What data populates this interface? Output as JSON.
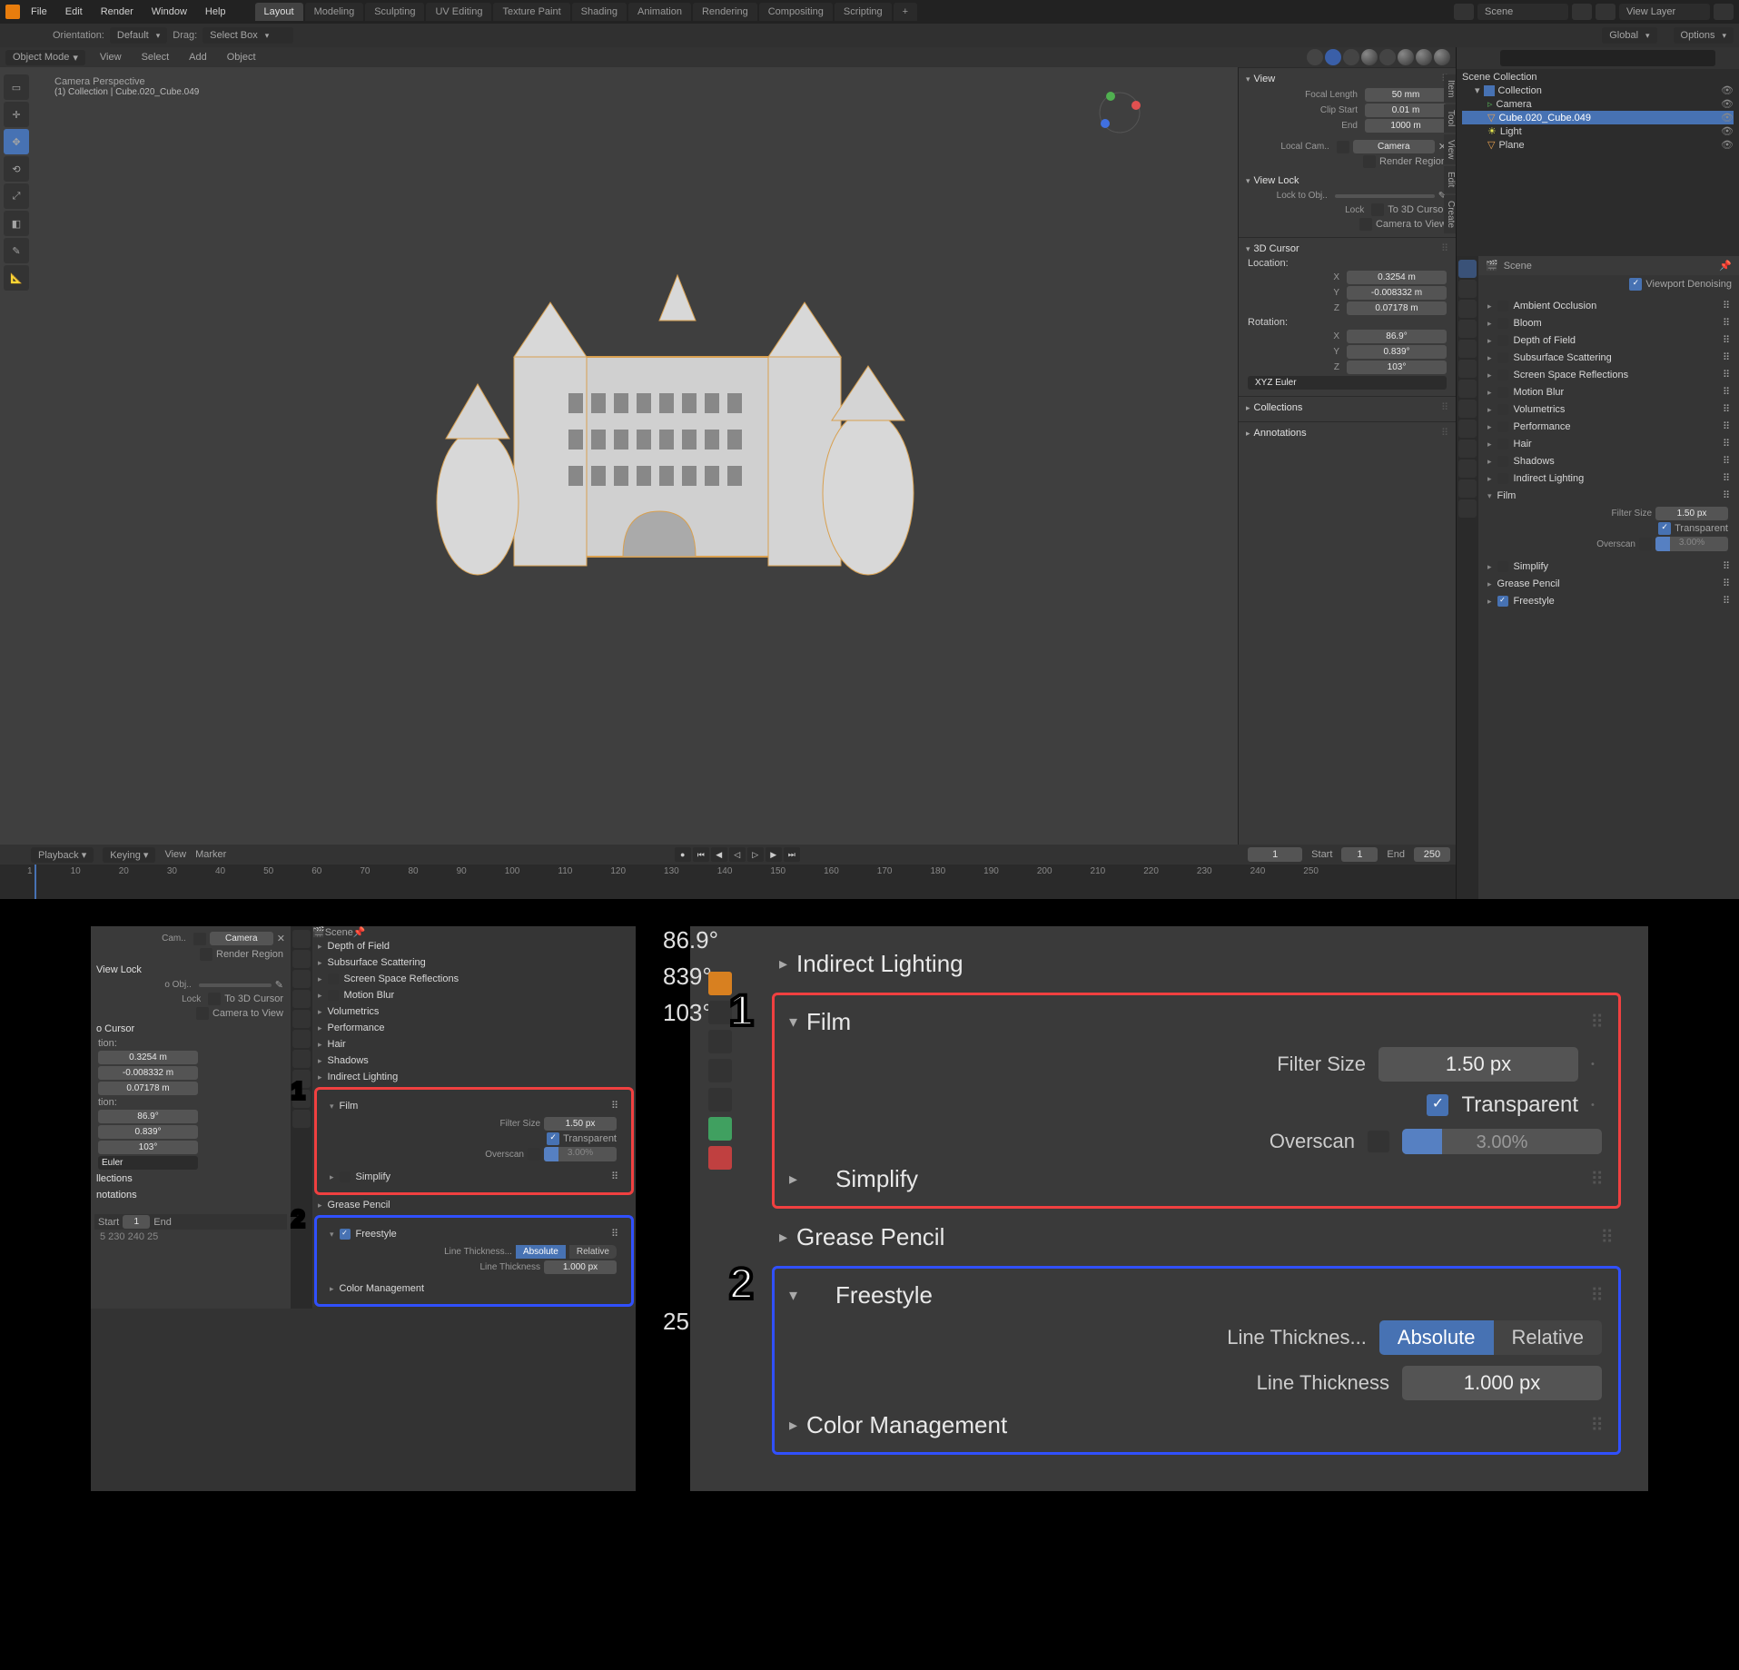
{
  "menus": [
    "File",
    "Edit",
    "Render",
    "Window",
    "Help"
  ],
  "workspaces": [
    "Layout",
    "Modeling",
    "Sculpting",
    "UV Editing",
    "Texture Paint",
    "Shading",
    "Animation",
    "Rendering",
    "Compositing",
    "Scripting"
  ],
  "active_workspace": "Layout",
  "scene_field": "Scene",
  "viewlayer_field": "View Layer",
  "secondbar": {
    "orientation_label": "Orientation:",
    "orientation_value": "Default",
    "drag_label": "Drag:",
    "drag_value": "Select Box",
    "transform_value": "Global",
    "options_label": "Options"
  },
  "vp_header": {
    "mode": "Object Mode",
    "menus": [
      "View",
      "Select",
      "Add",
      "Object"
    ]
  },
  "viewport_info": {
    "title": "Camera Perspective",
    "subtitle": "(1) Collection | Cube.020_Cube.049"
  },
  "sidepanel": {
    "view": {
      "title": "View",
      "focal_label": "Focal Length",
      "focal_value": "50 mm",
      "clipstart_label": "Clip Start",
      "clipstart_value": "0.01 m",
      "clipend_label": "End",
      "clipend_value": "1000 m",
      "localcam_label": "Local Cam..",
      "localcam_value": "Camera",
      "renderregion_label": "Render Region",
      "viewlock_title": "View Lock",
      "locktoobj_label": "Lock to Obj..",
      "lock_label": "Lock",
      "lock_3dcursor": "To 3D Cursor",
      "lock_camview": "Camera to View"
    },
    "cursor": {
      "title": "3D Cursor",
      "location_label": "Location:",
      "x": "X",
      "xv": "0.3254 m",
      "y": "Y",
      "yv": "-0.008332 m",
      "z": "Z",
      "zv": "0.07178 m",
      "rotation_label": "Rotation:",
      "rx": "X",
      "rxv": "86.9°",
      "ry": "Y",
      "ryv": "0.839°",
      "rz": "Z",
      "rzv": "103°",
      "mode": "XYZ Euler"
    },
    "collections_title": "Collections",
    "annotations_title": "Annotations"
  },
  "timeline": {
    "playback": "Playback",
    "keying": "Keying",
    "view": "View",
    "marker": "Marker",
    "frame": "1",
    "start_lbl": "Start",
    "start": "1",
    "end_lbl": "End",
    "end": "250",
    "ticks": [
      "1",
      "10",
      "20",
      "30",
      "40",
      "50",
      "60",
      "70",
      "80",
      "90",
      "100",
      "110",
      "120",
      "130",
      "140",
      "150",
      "160",
      "170",
      "180",
      "190",
      "200",
      "210",
      "220",
      "230",
      "240",
      "250"
    ]
  },
  "outliner": {
    "root": "Scene Collection",
    "collection": "Collection",
    "items": [
      {
        "name": "Camera"
      },
      {
        "name": "Cube.020_Cube.049"
      },
      {
        "name": "Light"
      },
      {
        "name": "Plane"
      }
    ],
    "selected": "Cube.020_Cube.049"
  },
  "props": {
    "scene_label": "Scene",
    "viewport_denoise": "Viewport Denoising",
    "sections": [
      "Ambient Occlusion",
      "Bloom",
      "Depth of Field",
      "Subsurface Scattering",
      "Screen Space Reflections",
      "Motion Blur",
      "Volumetrics",
      "Performance",
      "Hair",
      "Shadows",
      "Indirect Lighting"
    ],
    "film": {
      "title": "Film",
      "filter_lbl": "Filter Size",
      "filter_val": "1.50 px",
      "transparent_lbl": "Transparent",
      "overscan_lbl": "Overscan",
      "overscan_val": "3.00%"
    },
    "simplify": "Simplify",
    "grease": "Grease Pencil",
    "freestyle": {
      "title": "Freestyle",
      "thick_mode_lbl": "Line Thicknes...",
      "abs": "Absolute",
      "rel": "Relative",
      "thick_lbl": "Line Thickness",
      "thick_val": "1.000 px"
    },
    "colormgmt": "Color Management"
  },
  "inset1": {
    "cam_label": "Cam..",
    "cam_value": "Camera",
    "renderregion": "Render Region",
    "viewlock": "View Lock",
    "locktoobj": "o Obj..",
    "lock_lbl": "Lock",
    "to3d": "To 3D Cursor",
    "camview": "Camera to View",
    "cursor": "o Cursor",
    "tion": "tion:",
    "v1": "0.3254 m",
    "v2": "-0.008332 m",
    "v3": "0.07178 m",
    "rv1": "86.9°",
    "rv2": "0.839°",
    "rv3": "103°",
    "euler": "Euler",
    "llections": "llections",
    "notations": "notations",
    "start": "Start",
    "s1": "1",
    "end": "End",
    "ticks": "5   230   240   25",
    "scene": "Scene",
    "dof": "Depth of Field",
    "sss": "Subsurface Scattering",
    "ssr": "Screen Space Reflections",
    "mb": "Motion Blur",
    "vol": "Volumetrics",
    "perf": "Performance",
    "hair": "Hair",
    "shad": "Shadows",
    "indir": "Indirect Lighting",
    "film": "Film",
    "filtersize": "Filter Size",
    "filterval": "1.50 px",
    "transparent": "Transparent",
    "overscan": "Overscan",
    "overscanval": "3.00%",
    "simplify": "Simplify",
    "grease": "Grease Pencil",
    "freestyle": "Freestyle",
    "linethick": "Line Thickness...",
    "abs": "Absolute",
    "rel": "Relative",
    "linethick2": "Line Thickness",
    "thicknessval": "1.000 px",
    "colormgmt": "Color Management"
  },
  "inset2": {
    "ang1": "86.9°",
    "ang2": "839°",
    "ang3": "103°",
    "tick": "25",
    "indir": "Indirect Lighting",
    "film": "Film",
    "filtersize": "Filter Size",
    "filterval": "1.50 px",
    "transparent": "Transparent",
    "overscan": "Overscan",
    "overscanval": "3.00%",
    "simplify": "Simplify",
    "grease": "Grease Pencil",
    "freestyle": "Freestyle",
    "linethick": "Line Thicknes...",
    "abs": "Absolute",
    "rel": "Relative",
    "linethick2": "Line Thickness",
    "thickval": "1.000 px",
    "colormgmt": "Color Management"
  }
}
